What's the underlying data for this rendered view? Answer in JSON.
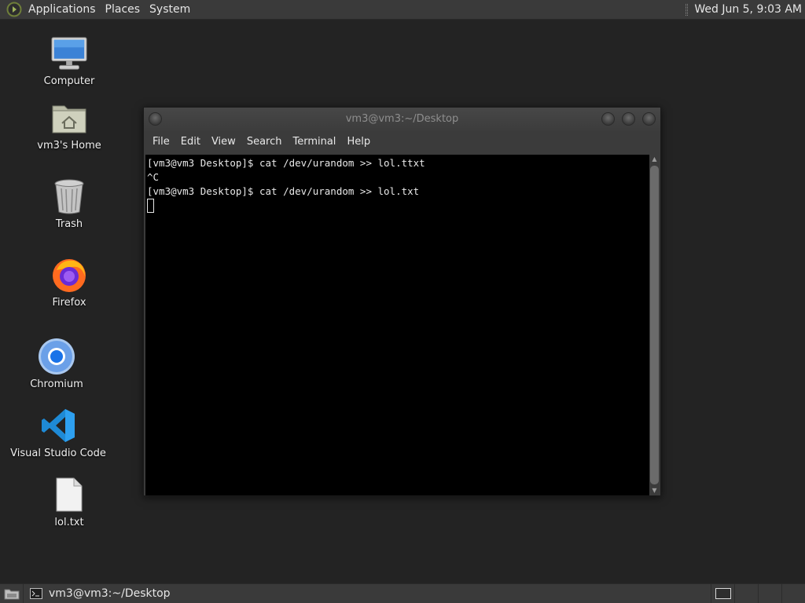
{
  "top_panel": {
    "menus": [
      "Applications",
      "Places",
      "System"
    ],
    "clock": "Wed Jun  5,  9:03 AM"
  },
  "desktop_icons": [
    {
      "label": "Computer",
      "icon": "computer-icon"
    },
    {
      "label": "vm3's Home",
      "icon": "home-folder-icon"
    },
    {
      "label": "Trash",
      "icon": "trash-icon"
    },
    {
      "label": "Firefox",
      "icon": "firefox-icon"
    },
    {
      "label": "Chromium",
      "icon": "chromium-icon"
    },
    {
      "label": "Visual Studio Code",
      "icon": "vscode-icon"
    },
    {
      "label": "lol.txt",
      "icon": "text-file-icon"
    }
  ],
  "terminal": {
    "title": "vm3@vm3:~/Desktop",
    "menu": [
      "File",
      "Edit",
      "View",
      "Search",
      "Terminal",
      "Help"
    ],
    "lines": [
      "[vm3@vm3 Desktop]$ cat /dev/urandom >> lol.ttxt",
      "^C",
      "[vm3@vm3 Desktop]$ cat /dev/urandom >> lol.txt"
    ]
  },
  "bottom_panel": {
    "task_label": "vm3@vm3:~/Desktop"
  }
}
